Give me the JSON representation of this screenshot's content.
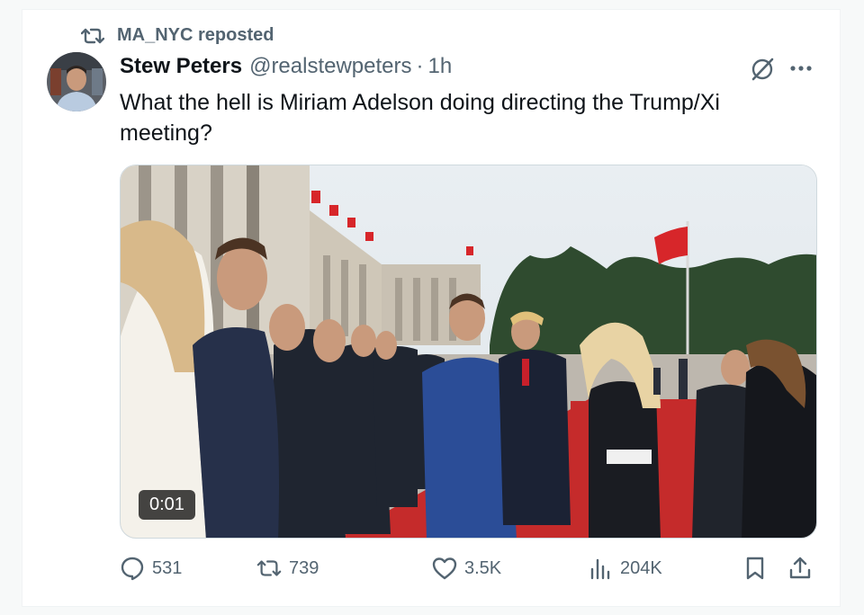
{
  "repost": {
    "text": "MA_NYC reposted",
    "icon": "repost-icon"
  },
  "tweet": {
    "author_name": "Stew Peters",
    "author_handle": "@realstewpeters",
    "separator": "·",
    "time": "1h",
    "text": "What the hell is Miriam Adelson doing directing the Trump/Xi meeting?"
  },
  "media": {
    "type": "video",
    "duration": "0:01"
  },
  "actions": {
    "replies": "531",
    "reposts": "739",
    "likes": "3.5K",
    "views": "204K"
  },
  "icons": {
    "grok": "grok-icon",
    "more": "more-icon",
    "reply": "reply-icon",
    "repost": "repost-icon",
    "like": "heart-icon",
    "views": "views-icon",
    "bookmark": "bookmark-icon",
    "share": "share-icon"
  },
  "colors": {
    "text_primary": "#0f1419",
    "text_secondary": "#536471",
    "border": "#cfd9de"
  }
}
